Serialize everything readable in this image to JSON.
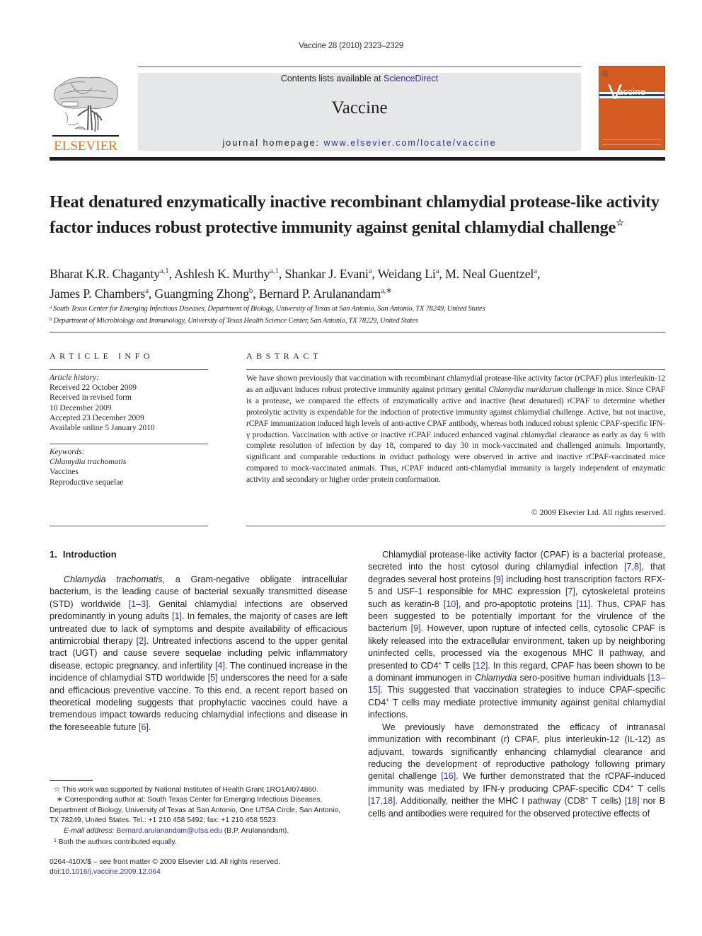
{
  "running_head": "Vaccine 28 (2010) 2323–2329",
  "masthead": {
    "publisher": "ELSEVIER",
    "contents_prefix": "Contents lists available at ",
    "contents_link": "ScienceDirect",
    "journal_name": "Vaccine",
    "homepage_prefix": "journal homepage: ",
    "homepage_link": "www.elsevier.com/locate/vaccine",
    "cover_title": "accine",
    "cover_initial": "V",
    "colors": {
      "cover": "#d35b22",
      "publisher_orange": "#e9711c",
      "link": "#2e3192",
      "masthead_bg": "#e6e7e8"
    }
  },
  "article": {
    "title": "Heat denatured enzymatically inactive recombinant chlamydial protease-like activity factor induces robust protective immunity against genital chlamydial challenge",
    "title_note_mark": "☆",
    "authors": [
      {
        "name": "Bharat K.R. Chaganty",
        "marks": "a,1"
      },
      {
        "name": "Ashlesh K. Murthy",
        "marks": "a,1"
      },
      {
        "name": "Shankar J. Evani",
        "marks": "a"
      },
      {
        "name": "Weidang Li",
        "marks": "a"
      },
      {
        "name": "M. Neal Guentzel",
        "marks": "a"
      },
      {
        "name": "James P. Chambers",
        "marks": "a"
      },
      {
        "name": "Guangming Zhong",
        "marks": "b"
      },
      {
        "name": "Bernard P. Arulanandam",
        "marks": "a,∗"
      }
    ],
    "affiliations": [
      {
        "mark": "a",
        "text": "South Texas Center for Emerging Infectious Diseases, Department of Biology, University of Texas at San Antonio, San Antonio, TX 78249, United States"
      },
      {
        "mark": "b",
        "text": "Department of Microbiology and Immunology, University of Texas Health Science Center, San Antonio, TX 78229, United States"
      }
    ]
  },
  "article_info": {
    "heading": "ARTICLE INFO",
    "history_label": "Article history:",
    "history": [
      "Received 22 October 2009",
      "Received in revised form",
      "10 December 2009",
      "Accepted 23 December 2009",
      "Available online 5 January 2010"
    ],
    "keywords_label": "Keywords:",
    "keywords": [
      "Chlamydia trachomatis",
      "Vaccines",
      "Reproductive sequelae"
    ]
  },
  "abstract": {
    "heading": "ABSTRACT",
    "p1": "We have shown previously that vaccination with recombinant chlamydial protease-like activity factor (rCPAF) plus interleukin-12 as an adjuvant induces robust protective immunity against primary genital ",
    "p1_italic": "Chlamydia muridarum",
    "p2": " challenge in mice. Since CPAF is a protease, we compared the effects of enzymatically active and inactive (heat denatured) rCPAF to determine whether proteolytic activity is expendable for the induction of protective immunity against chlamydial challenge. Active, but not inactive, rCPAF immunization induced high levels of anti-active CPAF antibody, whereas both induced robust splenic CPAF-specific IFN-γ production. Vaccination with active or inactive rCPAF induced enhanced vaginal chlamydial clearance as early as day 6 with complete resolution of infection by day 18, compared to day 30 in mock-vaccinated and challenged animals. Importantly, significant and comparable reductions in oviduct pathology were observed in active and inactive rCPAF-vaccinated mice compared to mock-vaccinated animals. Thus, rCPAF induced anti-chlamydial immunity is largely independent of enzymatic activity and secondary or higher order protein conformation.",
    "copyright": "© 2009 Elsevier Ltd. All rights reserved."
  },
  "introduction": {
    "number": "1.",
    "heading": "Introduction",
    "left": {
      "i1": "Chlamydia trachomatis",
      "t1": ", a Gram-negative obligate intracellular bacterium, is the leading cause of bacterial sexually transmitted disease (STD) worldwide ",
      "r1": "[1–3]",
      "t2": ". Genital chlamydial infections are observed predominantly in young adults ",
      "r2": "[1]",
      "t3": ". In females, the majority of cases are left untreated due to lack of symptoms and despite availability of efficacious antimicrobial therapy ",
      "r3": "[2]",
      "t4": ". Untreated infections ascend to the upper genital tract (UGT) and cause severe sequelae including pelvic inflammatory disease, ectopic pregnancy, and infertility ",
      "r4": "[4]",
      "t5": ". The continued increase in the incidence of chlamydial STD worldwide ",
      "r5": "[5]",
      "t6": " underscores the need for a safe and efficacious preventive vaccine. To this end, a recent report based on theoretical modeling suggests that prophylactic vaccines could have a tremendous impact towards reducing chlamydial infections and disease in the foreseeable future ",
      "r6": "[6]",
      "t7": "."
    },
    "right_p1": {
      "t1": "Chlamydial protease-like activity factor (CPAF) is a bacterial protease, secreted into the host cytosol during chlamydial infection ",
      "r1": "[7,8]",
      "t2": ", that degrades several host proteins ",
      "r2": "[9]",
      "t3": " including host transcription factors RFX-5 and USF-1 responsible for MHC expression ",
      "r3": "[7]",
      "t4": ", cytoskeletal proteins such as keratin-8 ",
      "r4": "[10]",
      "t5": ", and pro-apoptotic proteins ",
      "r5": "[11]",
      "t6": ". Thus, CPAF has been suggested to be potentially important for the virulence of the bacterium ",
      "r6": "[9]",
      "t7": ". However, upon rupture of infected cells, cytosolic CPAF is likely released into the extracellular environment, taken up by neighboring uninfected cells, processed via the exogenous MHC II pathway, and presented to CD4",
      "sup1": "+",
      "t8": " T cells ",
      "r7": "[12]",
      "t9": ". In this regard, CPAF has been shown to be a dominant immunogen in ",
      "i1": "Chlamydia",
      "t10": " sero-positive human individuals ",
      "r8": "[13–15]",
      "t11": ". This suggested that vaccination strategies to induce CPAF-specific CD4",
      "sup2": "+",
      "t12": " T cells may mediate protective immunity against genital chlamydial infections."
    },
    "right_p2": {
      "t1": "We previously have demonstrated the efficacy of intranasal immunization with recombinant (r) CPAF, plus interleukin-12 (IL-12) as adjuvant, towards significantly enhancing chlamydial clearance and reducing the development of reproductive pathology following primary genital challenge ",
      "r1": "[16]",
      "t2": ". We further demonstrated that the rCPAF-induced immunity was mediated by IFN-γ producing CPAF-specific CD4",
      "sup1": "+",
      "t3": " T cells ",
      "r2": "[17,18]",
      "t4": ". Additionally, neither the MHC I pathway (CD8",
      "sup2": "+",
      "t5": " T cells) ",
      "r3": "[18]",
      "t6": " nor B cells and antibodies were required for the observed protective effects of"
    }
  },
  "footnotes": {
    "funding_mark": "☆",
    "funding": "This work was supported by National Institutes of Health Grant 1RO1AI074860.",
    "corresponding_mark": "∗",
    "corresponding": "Corresponding author at: South Texas Center for Emerging Infectious Diseases, Department of Biology, University of Texas at San Antonio, One UTSA Circle, San Antonio, TX 78249, United States. Tel.: +1 210 458 5492; fax: +1 210 458 5523.",
    "email_label": "E-mail address:",
    "email": "Bernard.arulanandam@utsa.edu",
    "email_suffix": " (B.P. Arulanandam).",
    "equal_mark": "1",
    "equal": "Both the authors contributed equally."
  },
  "front_matter": {
    "issn_line": "0264-410X/$ – see front matter © 2009 Elsevier Ltd. All rights reserved.",
    "doi_prefix": "doi:",
    "doi": "10.1016/j.vaccine.2009.12.064"
  }
}
